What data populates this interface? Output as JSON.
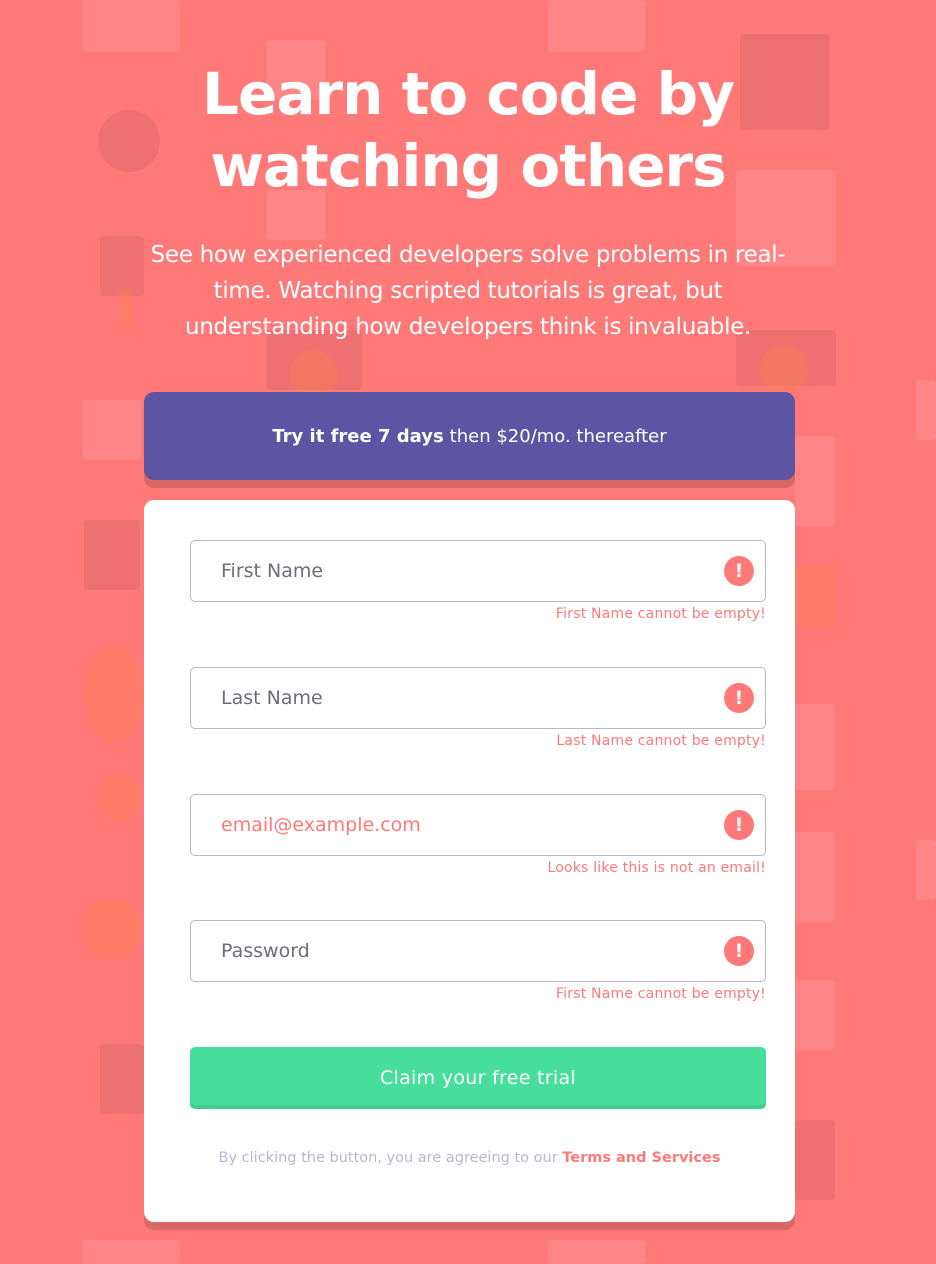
{
  "hero": {
    "title": "Learn to code by watching others",
    "description": "See how experienced developers solve problems in real-time. Watching scripted tutorials is great, but understanding how developers think is invaluable."
  },
  "promo": {
    "highlight": "Try it free 7 days",
    "rest": "then $20/mo. thereafter"
  },
  "form": {
    "fields": [
      {
        "placeholder": "First Name",
        "error": "First Name cannot be empty!",
        "icon": "error-icon"
      },
      {
        "placeholder": "Last Name",
        "error": "Last Name cannot be empty!",
        "icon": "error-icon"
      },
      {
        "placeholder": "email@example.com",
        "error": "Looks like this is not an email!",
        "icon": "error-icon"
      },
      {
        "placeholder": "Password",
        "error": "First Name cannot be empty!",
        "icon": "error-icon"
      }
    ],
    "error_icon_glyph": "!",
    "submit_label": "Claim your free trial",
    "terms_prefix": "By clicking the button, you are agreeing to our",
    "terms_link": "Terms and Services"
  },
  "colors": {
    "background": "#ff7979",
    "promo": "#5e54a4",
    "submit": "#47dd9b",
    "error": "#ff7979",
    "text_muted": "#b9b6d3"
  }
}
